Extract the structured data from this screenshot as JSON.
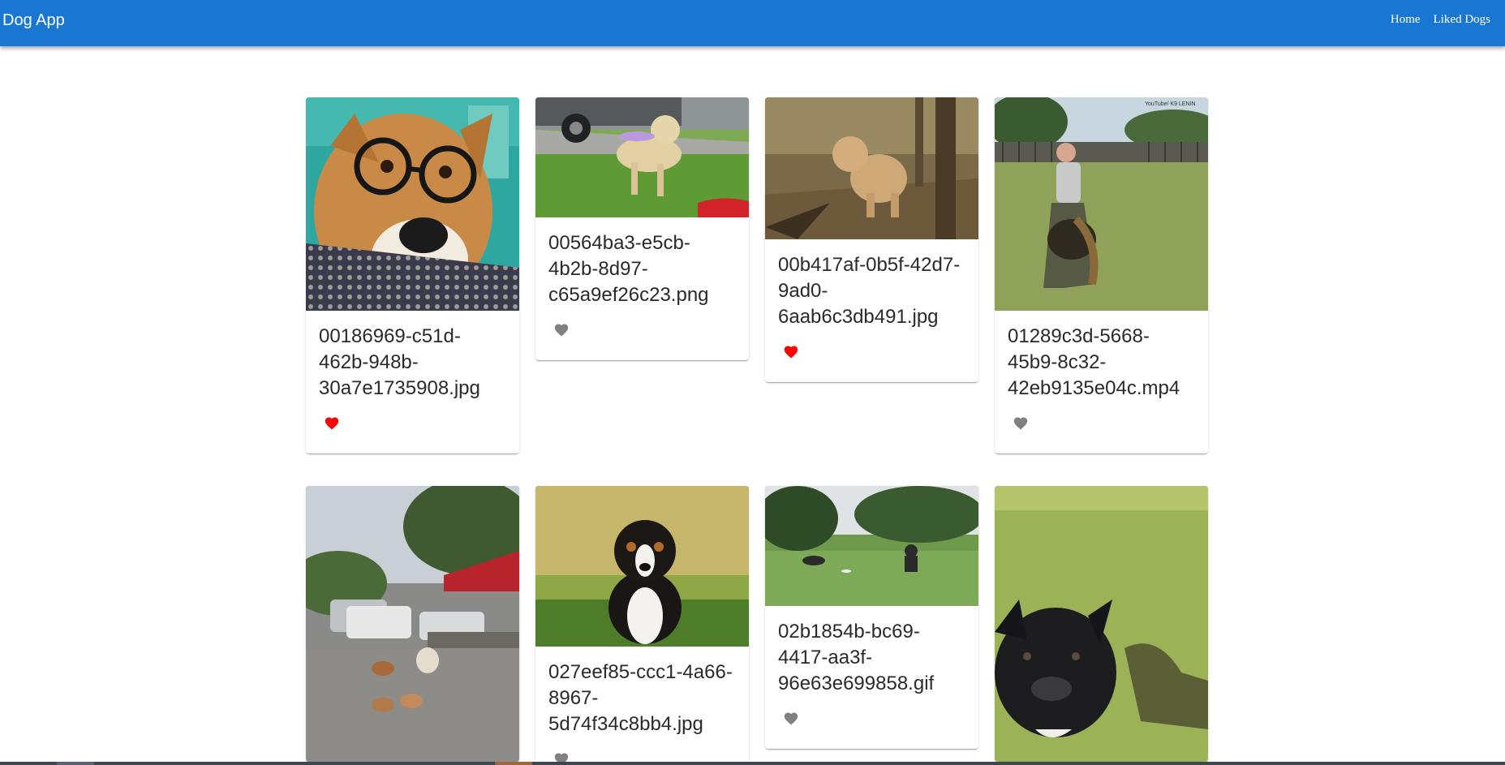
{
  "app": {
    "title": "Dog App"
  },
  "nav": {
    "links": [
      "Home",
      "Liked Dogs"
    ]
  },
  "colors": {
    "appbar": "#1976d2",
    "liked": "#ff0000",
    "unliked": "#808080"
  },
  "dogs": [
    {
      "filename": "00186969-c51d-462b-948b-30a7e1735908.jpg",
      "liked": true,
      "image": "corgi-with-glasses"
    },
    {
      "filename": "00564ba3-e5cb-4b2b-8d97-c65a9ef26c23.png",
      "liked": false,
      "image": "dog-with-frisbee"
    },
    {
      "filename": "00b417af-0b5f-42d7-9ad0-6aab6c3db491.jpg",
      "liked": true,
      "image": "doodle-in-woods"
    },
    {
      "filename": "01289c3d-5668-45b9-8c32-42eb9135e04c.mp4",
      "liked": false,
      "image": "shepherd-training"
    },
    {
      "filename": "",
      "liked": null,
      "image": "dogs-parking-lot"
    },
    {
      "filename": "027eef85-ccc1-4a66-8967-5d74f34c8bb4.jpg",
      "liked": false,
      "image": "bernese-puppy"
    },
    {
      "filename": "02b1854b-bc69-4417-aa3f-96e63e699858.gif",
      "liked": false,
      "image": "dogs-in-field"
    },
    {
      "filename": "",
      "liked": null,
      "image": "black-dog-grass"
    }
  ]
}
